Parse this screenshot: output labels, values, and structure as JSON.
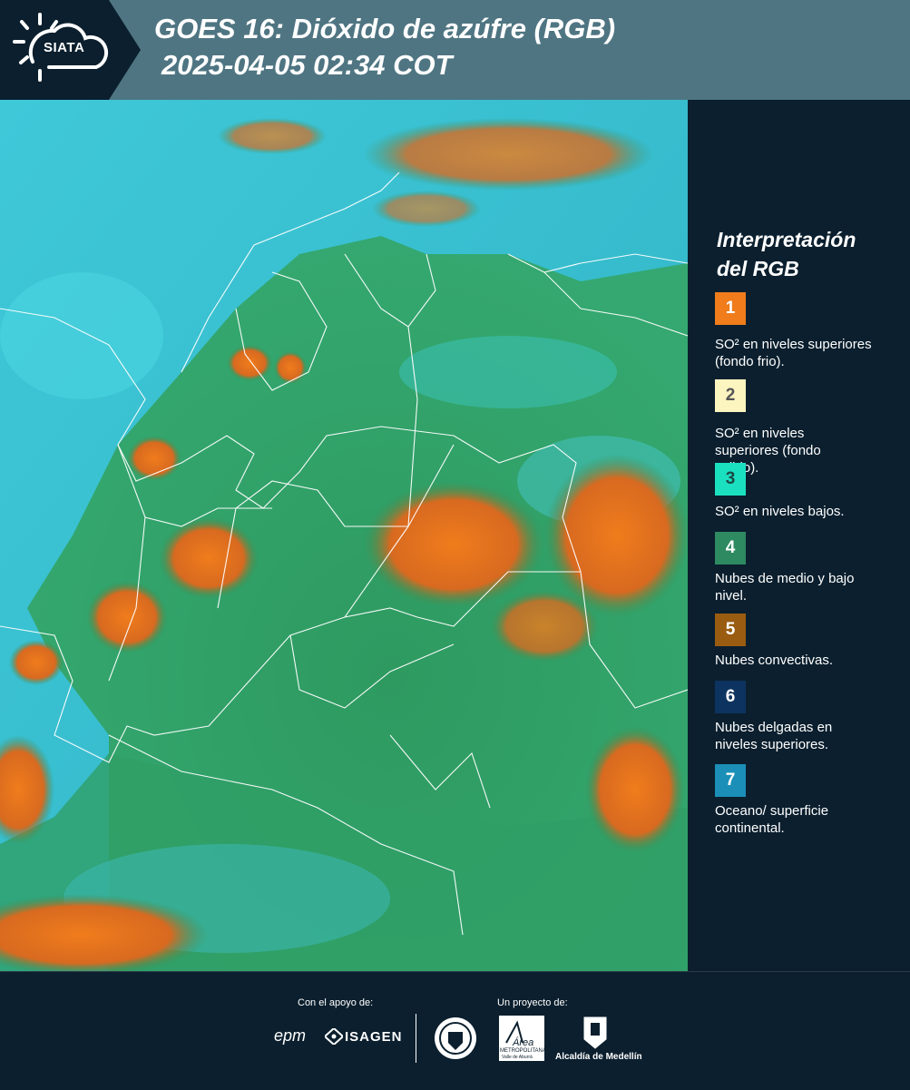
{
  "header": {
    "brand": "SIATA",
    "title_line1": "GOES 16: Dióxido de azúfre (RGB)",
    "title_line2": "2025-04-05 02:34 COT"
  },
  "legend": {
    "title_line1": "Interpretación",
    "title_line2": "del RGB",
    "items": [
      {
        "num": "1",
        "color": "#f07c1c",
        "text": "SO² en niveles superiores (fondo frio)."
      },
      {
        "num": "2",
        "color": "#fdf5c0",
        "text": "SO² en niveles superiores (fondo calido)."
      },
      {
        "num": "3",
        "color": "#1be0c0",
        "text": "SO² en niveles bajos."
      },
      {
        "num": "4",
        "color": "#2e8a60",
        "text": "Nubes de medio y bajo nivel."
      },
      {
        "num": "5",
        "color": "#9a5c10",
        "text": "Nubes convectivas."
      },
      {
        "num": "6",
        "color": "#0d3460",
        "text": "Nubes delgadas en niveles superiores."
      },
      {
        "num": "7",
        "color": "#1b8fb8",
        "text": "Oceano/ superficie continental."
      }
    ]
  },
  "footer": {
    "support_label": "Con el apoyo de:",
    "project_label": "Un proyecto de:",
    "sponsor_epm": "epm",
    "sponsor_isagen": "ISAGEN",
    "area_name": "Área",
    "area_sub1": "METROPOLITANA",
    "area_sub2": "Valle de Aburrá",
    "alcaldia": "Alcaldía de Medellín"
  }
}
